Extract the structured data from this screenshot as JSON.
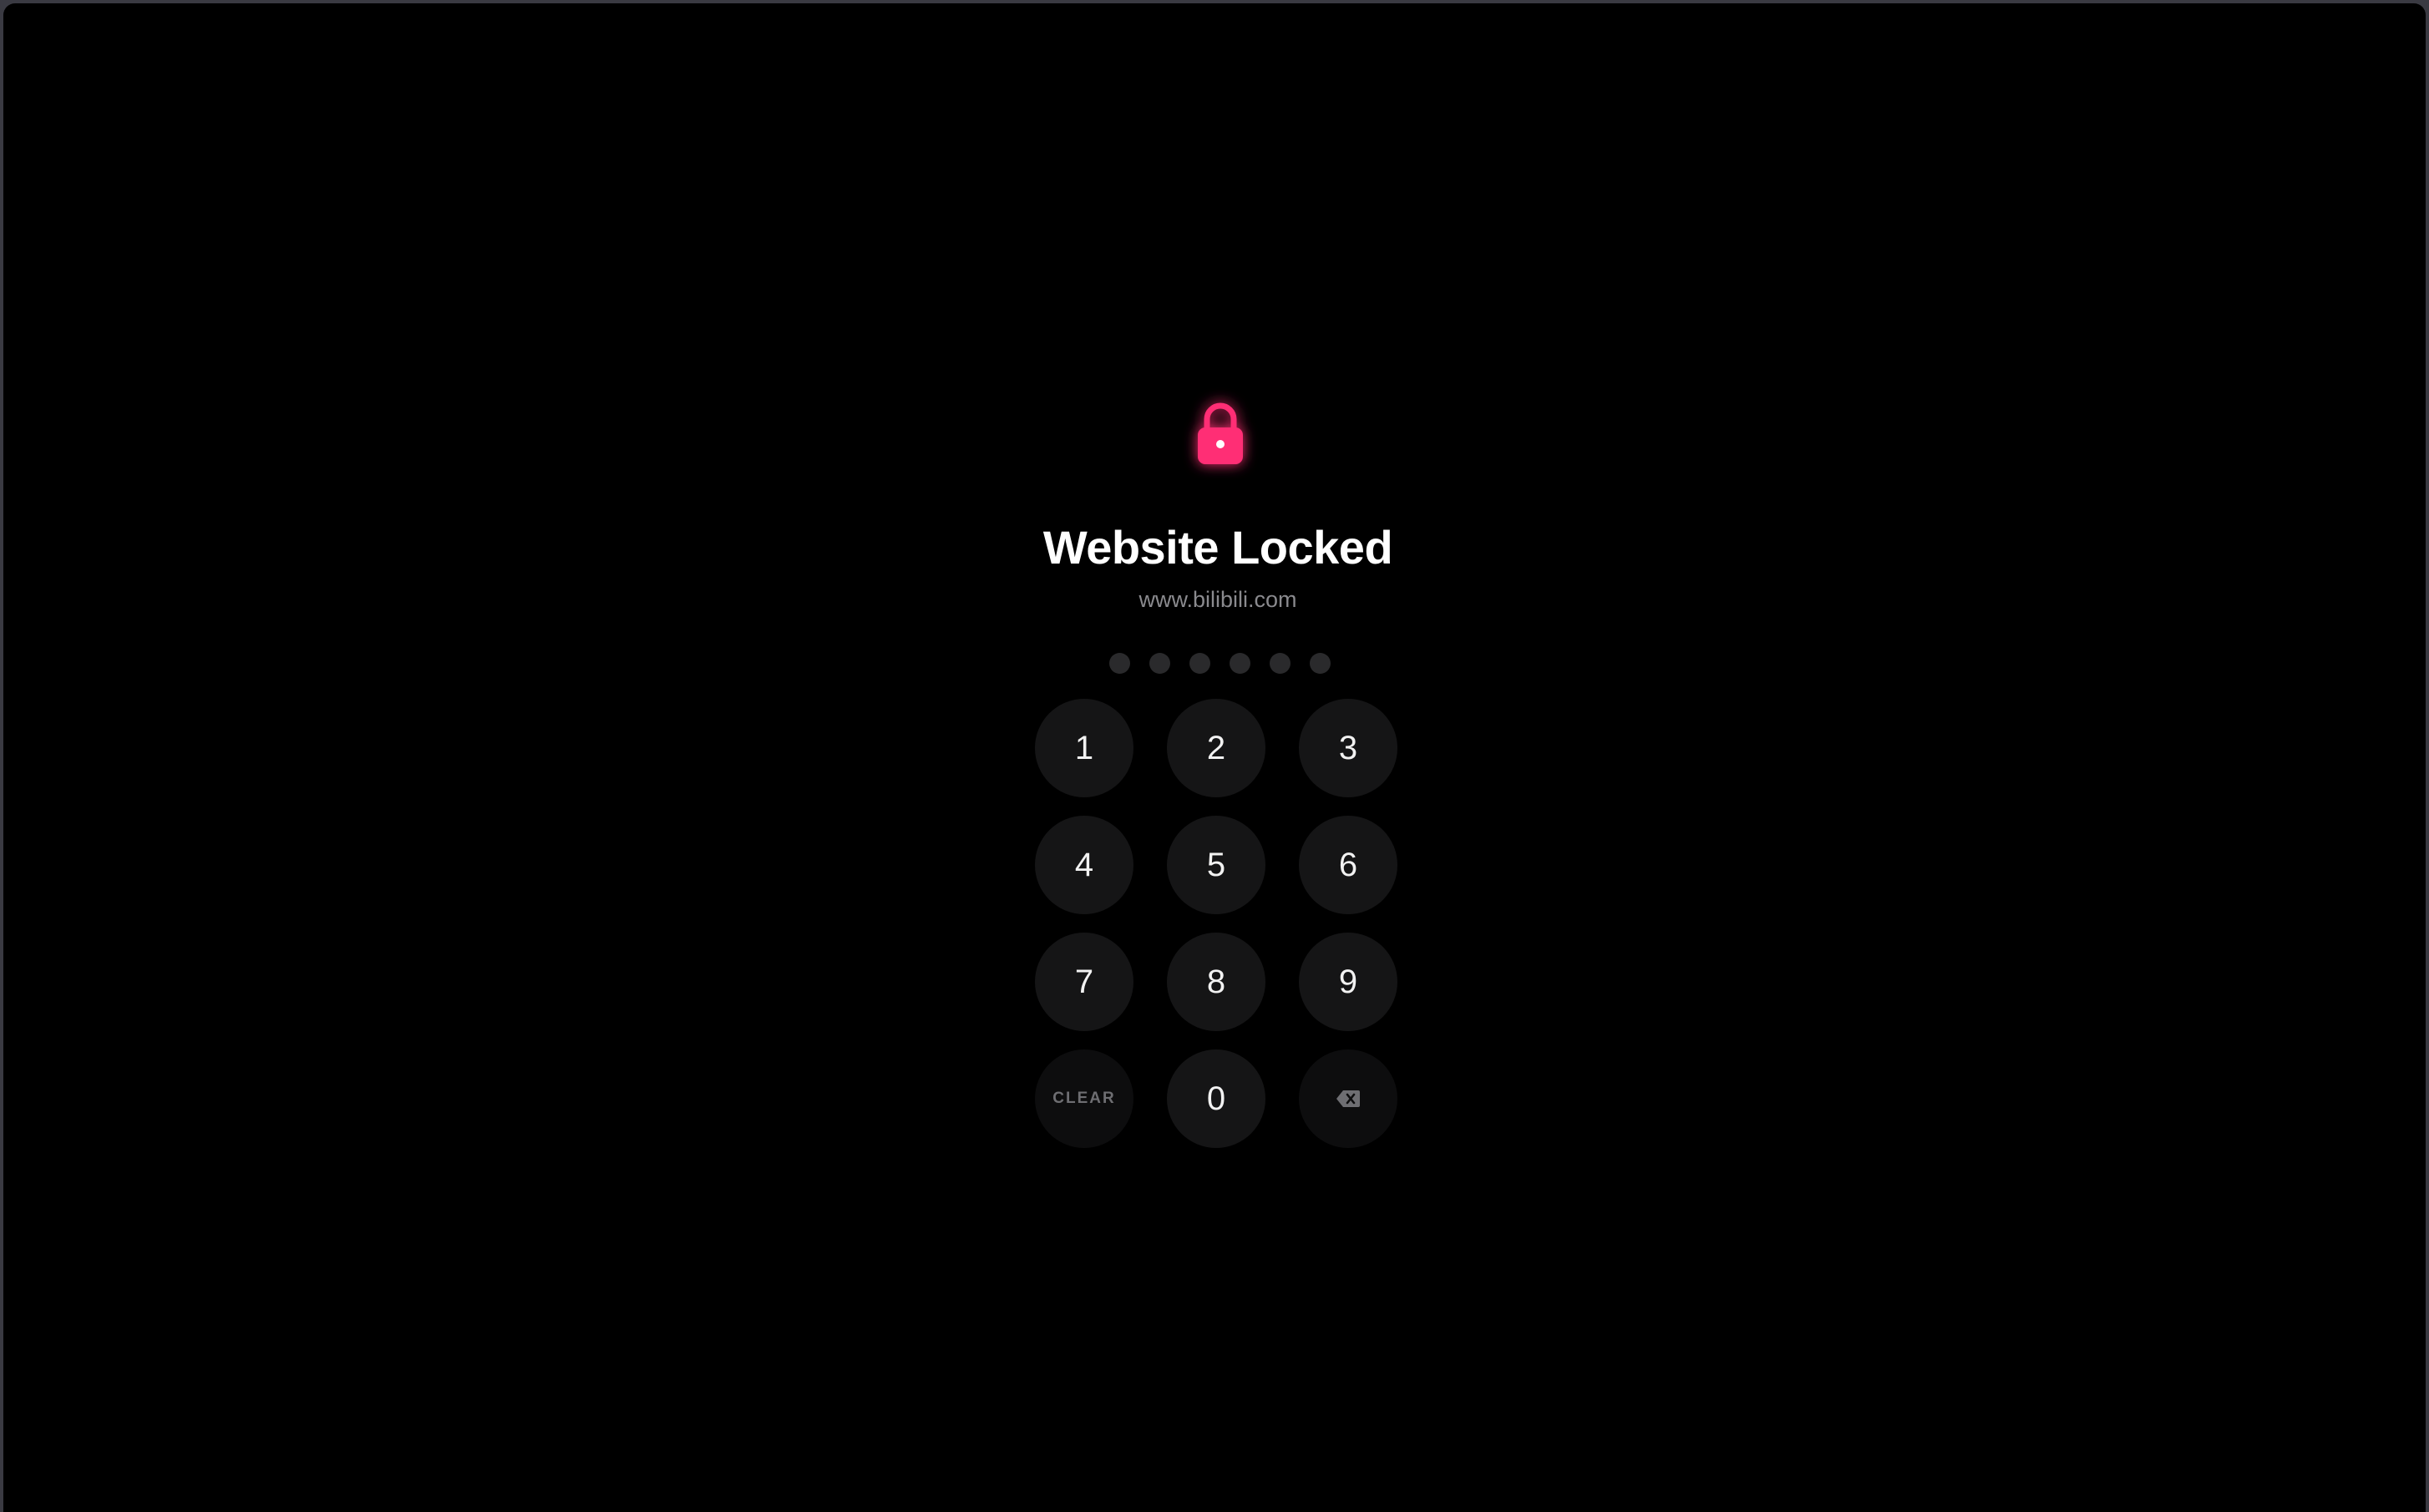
{
  "lock": {
    "icon": "lock-icon",
    "color": "#ff2e74"
  },
  "title": "Website Locked",
  "domain": "www.bilibili.com",
  "passcode": {
    "length": 6,
    "filled": 0,
    "dot_color": "#2a2a2c"
  },
  "keypad": {
    "digits": [
      "1",
      "2",
      "3",
      "4",
      "5",
      "6",
      "7",
      "8",
      "9"
    ],
    "zero": "0",
    "clear_label": "CLEAR",
    "backspace_icon": "backspace-icon"
  },
  "colors": {
    "background": "#000000",
    "key_background": "#151516",
    "title": "#ffffff",
    "subtitle": "#8a8a8e"
  }
}
